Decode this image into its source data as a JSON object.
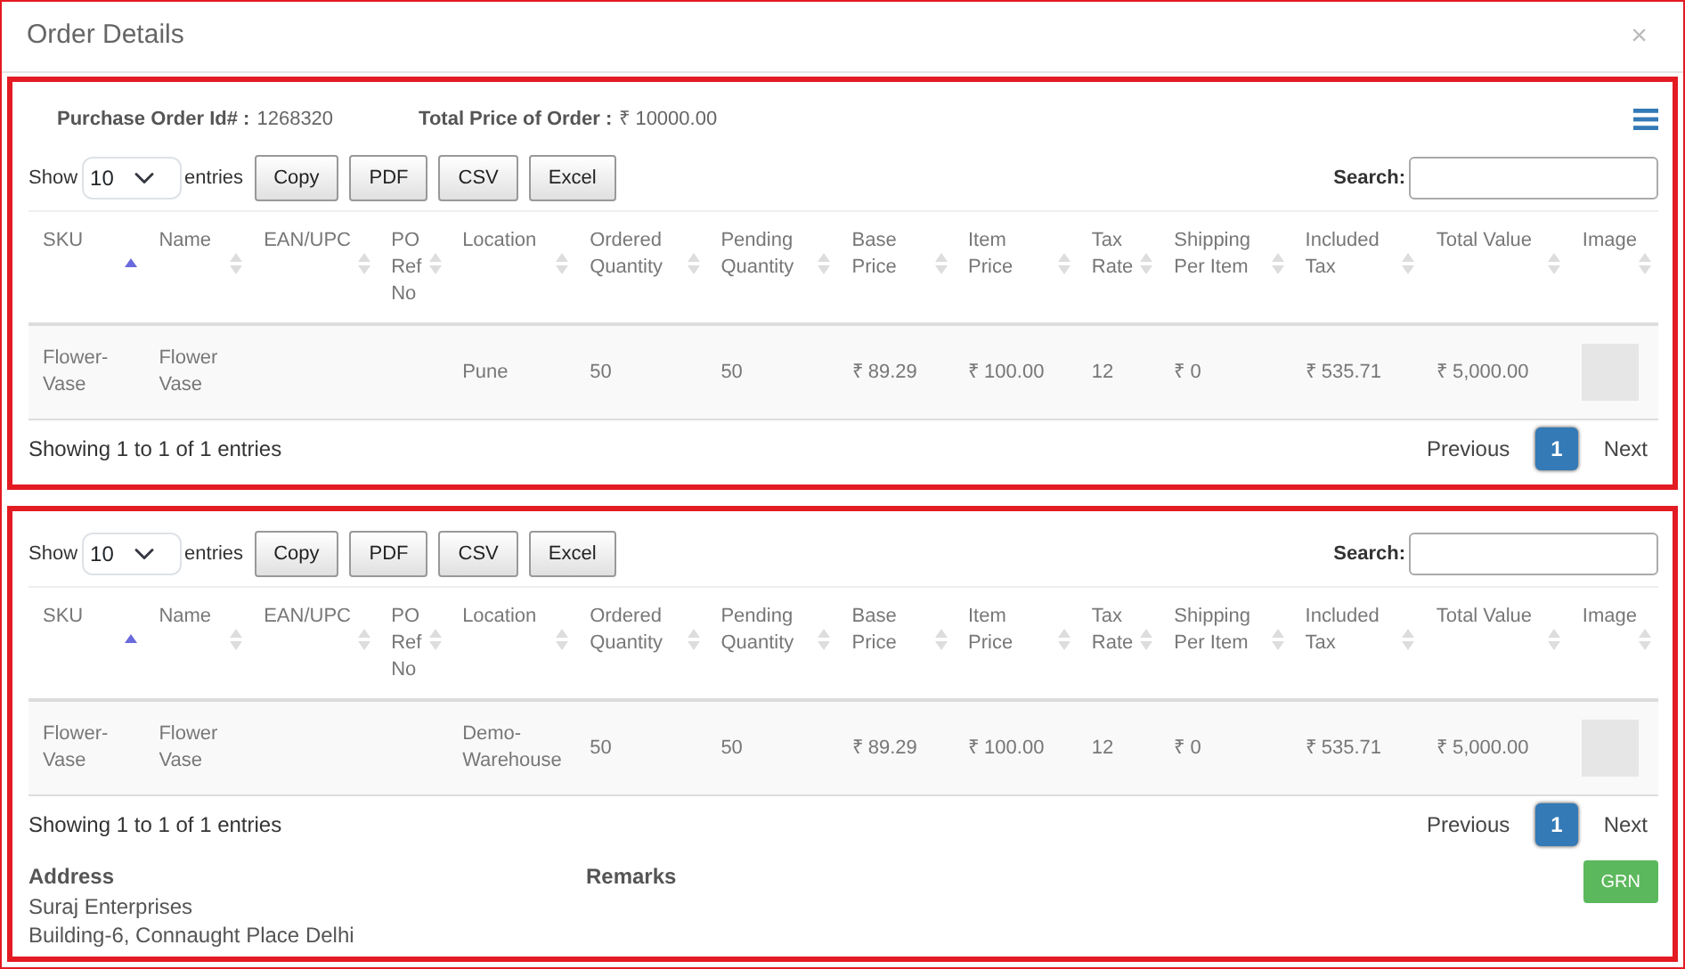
{
  "modal": {
    "title": "Order Details",
    "close": "×"
  },
  "summary": {
    "po_label": "Purchase Order Id# :",
    "po_value": "1268320",
    "total_label": "Total Price of Order :",
    "total_value": "₹ 10000.00"
  },
  "tables": [
    {
      "show_label": "Show",
      "length": "10",
      "entries_label": "entries",
      "buttons": [
        "Copy",
        "PDF",
        "CSV",
        "Excel"
      ],
      "search_label": "Search:",
      "columns": [
        {
          "label": "SKU",
          "sorted": true
        },
        {
          "label": "Name",
          "sorted": false
        },
        {
          "label": "EAN/UPC",
          "sorted": false
        },
        {
          "label": "PO Ref No",
          "sorted": false
        },
        {
          "label": "Location",
          "sorted": false
        },
        {
          "label": "Ordered Quantity",
          "sorted": false
        },
        {
          "label": "Pending Quantity",
          "sorted": false
        },
        {
          "label": "Base Price",
          "sorted": false
        },
        {
          "label": "Item Price",
          "sorted": false
        },
        {
          "label": "Tax Rate",
          "sorted": false
        },
        {
          "label": "Shipping Per Item",
          "sorted": false
        },
        {
          "label": "Included Tax",
          "sorted": false
        },
        {
          "label": "Total Value",
          "sorted": false
        },
        {
          "label": "Image",
          "sorted": false
        }
      ],
      "rows": [
        {
          "cells": [
            "Flower-Vase",
            "Flower Vase",
            "",
            "",
            "Pune",
            "50",
            "50",
            "₹ 89.29",
            "₹ 100.00",
            "12",
            "₹ 0",
            "₹ 535.71",
            "₹ 5,000.00"
          ],
          "has_image": true
        }
      ],
      "info": "Showing 1 to 1 of 1 entries",
      "pagination": [
        {
          "label": "Previous",
          "selected": false
        },
        {
          "label": "1",
          "selected": true
        },
        {
          "label": "Next",
          "selected": false
        }
      ]
    },
    {
      "show_label": "Show",
      "length": "10",
      "entries_label": "entries",
      "buttons": [
        "Copy",
        "PDF",
        "CSV",
        "Excel"
      ],
      "search_label": "Search:",
      "columns": [
        {
          "label": "SKU",
          "sorted": true
        },
        {
          "label": "Name",
          "sorted": false
        },
        {
          "label": "EAN/UPC",
          "sorted": false
        },
        {
          "label": "PO Ref No",
          "sorted": false
        },
        {
          "label": "Location",
          "sorted": false
        },
        {
          "label": "Ordered Quantity",
          "sorted": false
        },
        {
          "label": "Pending Quantity",
          "sorted": false
        },
        {
          "label": "Base Price",
          "sorted": false
        },
        {
          "label": "Item Price",
          "sorted": false
        },
        {
          "label": "Tax Rate",
          "sorted": false
        },
        {
          "label": "Shipping Per Item",
          "sorted": false
        },
        {
          "label": "Included Tax",
          "sorted": false
        },
        {
          "label": "Total Value",
          "sorted": false
        },
        {
          "label": "Image",
          "sorted": false
        }
      ],
      "rows": [
        {
          "cells": [
            "Flower-Vase",
            "Flower Vase",
            "",
            "",
            "Demo-Warehouse",
            "50",
            "50",
            "₹ 89.29",
            "₹ 100.00",
            "12",
            "₹ 0",
            "₹ 535.71",
            "₹ 5,000.00"
          ],
          "has_image": true
        }
      ],
      "info": "Showing 1 to 1 of 1 entries",
      "pagination": [
        {
          "label": "Previous",
          "selected": false
        },
        {
          "label": "1",
          "selected": true
        },
        {
          "label": "Next",
          "selected": false
        }
      ]
    }
  ],
  "footer": {
    "address_label": "Address",
    "address_lines": [
      "Suraj Enterprises",
      "Building-6, Connaught Place Delhi"
    ],
    "remarks_label": "Remarks",
    "grn_button": "GRN"
  }
}
